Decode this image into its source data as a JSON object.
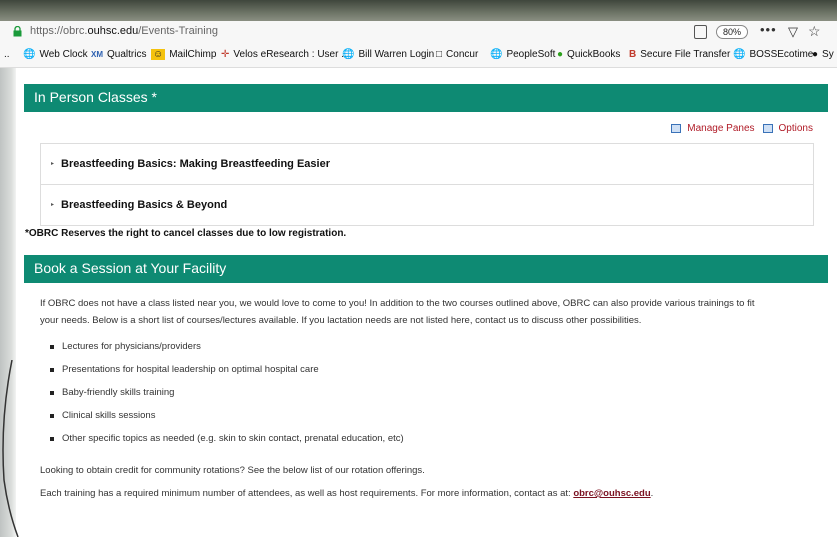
{
  "browser": {
    "url_prefix": "https://obrc.",
    "url_domain": "ouhsc.edu",
    "url_path": "/Events-Training",
    "zoom": "80%",
    "more_label": "•••"
  },
  "bookmarks": [
    {
      "label": "Web Clock"
    },
    {
      "label": "Qualtrics"
    },
    {
      "label": "MailChimp"
    },
    {
      "label": "Velos eResearch : User ..."
    },
    {
      "label": "Bill Warren Login"
    },
    {
      "label": "Concur"
    },
    {
      "label": "PeopleSoft"
    },
    {
      "label": "QuickBooks"
    },
    {
      "label": "Secure File Transfer"
    },
    {
      "label": "BOSSEcotime"
    },
    {
      "label": "Sy"
    }
  ],
  "in_person": {
    "title": "In Person Classes *",
    "manage_panes": "Manage Panes",
    "options": "Options",
    "classes": [
      {
        "label": "Breastfeeding Basics: Making Breastfeeding Easier"
      },
      {
        "label": "Breastfeeding Basics & Beyond"
      }
    ],
    "note": "*OBRC Reserves the right to cancel classes due to low registration."
  },
  "book_session": {
    "title": "Book a Session at Your Facility",
    "intro_line1": "If OBRC does not have a class listed near you, we would love to come to you!  In addition to the two courses outlined above, OBRC can also provide various trainings to fit",
    "intro_line2": "your needs.  Below is a short list of courses/lectures available.  If you lactation needs are not listed here, contact us to discuss other possibilities.",
    "items": [
      "Lectures for physicians/providers",
      "Presentations for hospital leadership on optimal hospital care",
      "Baby-friendly skills training",
      "Clinical skills sessions",
      "Other specific topics as needed (e.g. skin to skin contact, prenatal education, etc)"
    ],
    "credit_text": "Looking to obtain credit for community rotations?  See the below list of our rotation offerings.",
    "host_text": "Each training has a required minimum number of attendees, as well as host requirements. For more information, contact as at: ",
    "email": "obrc@ouhsc.edu",
    "host_suffix": "."
  }
}
